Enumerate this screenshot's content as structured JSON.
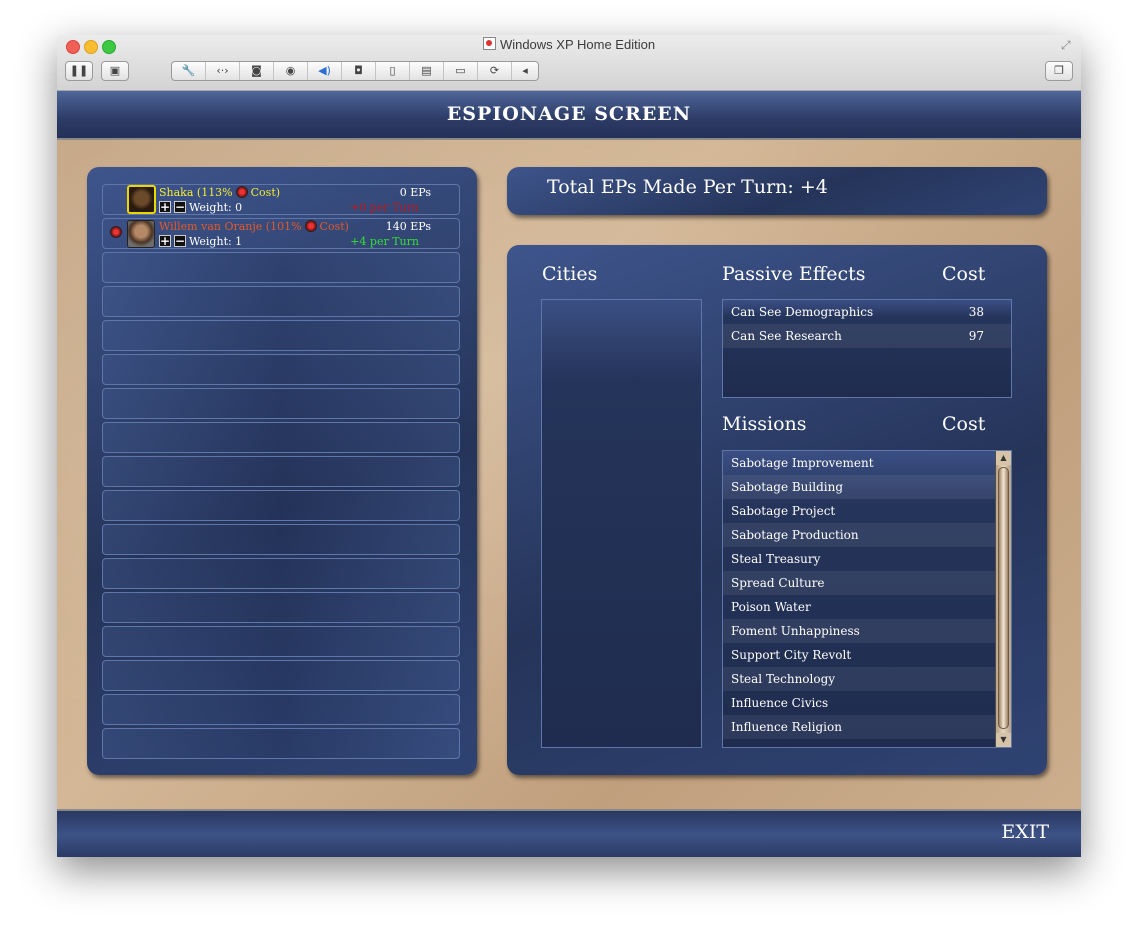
{
  "window": {
    "title": "Windows XP Home Edition",
    "toolbar_icons": [
      "pause-icon",
      "snapshot-icon",
      "settings-icon",
      "network-icon",
      "disk-icon",
      "cd-icon",
      "sound-icon",
      "camera-icon",
      "usb-icon",
      "printer-icon",
      "storage-icon",
      "sync-icon",
      "collapse-icon",
      "window-icon"
    ]
  },
  "screen": {
    "title": "ESPIONAGE SCREEN",
    "exit_label": "EXIT",
    "total_eps": "Total EPs Made Per Turn: +4"
  },
  "civs": [
    {
      "name": "Shaka (113%",
      "name_suffix": "Cost)",
      "eps": "0 EPs",
      "plus": "+",
      "minus": "−",
      "weight": "Weight: 0",
      "per_turn": "+0 per Turn",
      "name_color": "#f2ea3a",
      "per_turn_color": "#c01818"
    },
    {
      "name": "Willem van Oranje (101%",
      "name_suffix": "Cost)",
      "eps": "140 EPs",
      "plus": "+",
      "minus": "−",
      "weight": "Weight: 1",
      "per_turn": "+4 per Turn",
      "name_color": "#e05a2a",
      "per_turn_color": "#33e033"
    }
  ],
  "empty_rows": 15,
  "headers": {
    "cities": "Cities",
    "passive": "Passive Effects",
    "passive_cost": "Cost",
    "missions": "Missions",
    "missions_cost": "Cost"
  },
  "passive_effects": [
    {
      "name": "Can See Demographics",
      "cost": "38"
    },
    {
      "name": "Can See Research",
      "cost": "97"
    }
  ],
  "missions": [
    "Sabotage Improvement",
    "Sabotage Building",
    "Sabotage Project",
    "Sabotage Production",
    "Steal Treasury",
    "Spread Culture",
    "Poison Water",
    "Foment Unhappiness",
    "Support City Revolt",
    "Steal Technology",
    "Influence Civics",
    "Influence Religion"
  ],
  "colors": {
    "panel_blue": "#2c3d6a",
    "parchment": "#c9ab89"
  }
}
